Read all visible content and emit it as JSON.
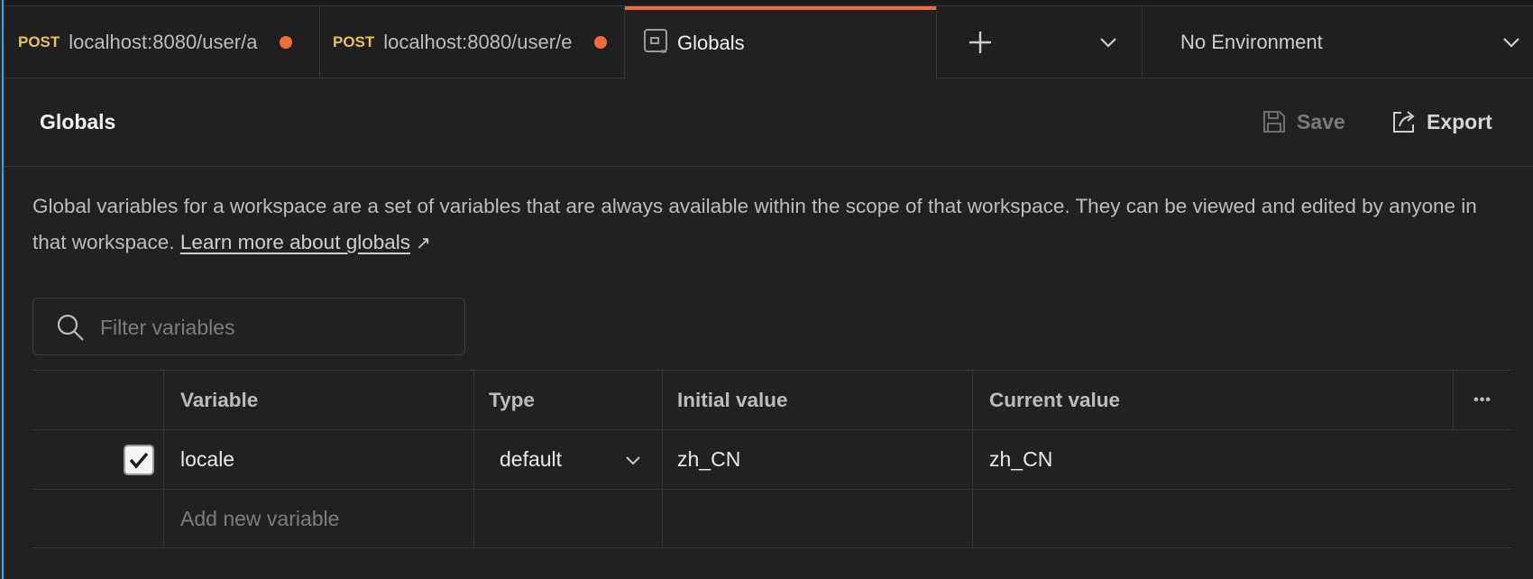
{
  "tabs": [
    {
      "method": "POST",
      "url": "localhost:8080/user/a",
      "unsaved": true
    },
    {
      "method": "POST",
      "url": "localhost:8080/user/e",
      "unsaved": true
    },
    {
      "title": "Globals",
      "active": true
    }
  ],
  "environment": {
    "selected": "No Environment"
  },
  "header": {
    "title": "Globals",
    "save_label": "Save",
    "export_label": "Export"
  },
  "description": {
    "text": "Global variables for a workspace are a set of variables that are always available within the scope of that workspace. They can be viewed and edited by anyone in that workspace. ",
    "link_text": "Learn more about globals",
    "link_arrow": "↗"
  },
  "search": {
    "placeholder": "Filter variables"
  },
  "table": {
    "columns": [
      "Variable",
      "Type",
      "Initial value",
      "Current value"
    ],
    "more_label": "•••",
    "rows": [
      {
        "enabled": true,
        "variable": "locale",
        "type": "default",
        "initial_value": "zh_CN",
        "current_value": "zh_CN"
      }
    ],
    "new_row_placeholder": "Add new variable"
  },
  "colors": {
    "accent": "#f26b3a",
    "method": "#e8c063",
    "background": "#212121"
  }
}
